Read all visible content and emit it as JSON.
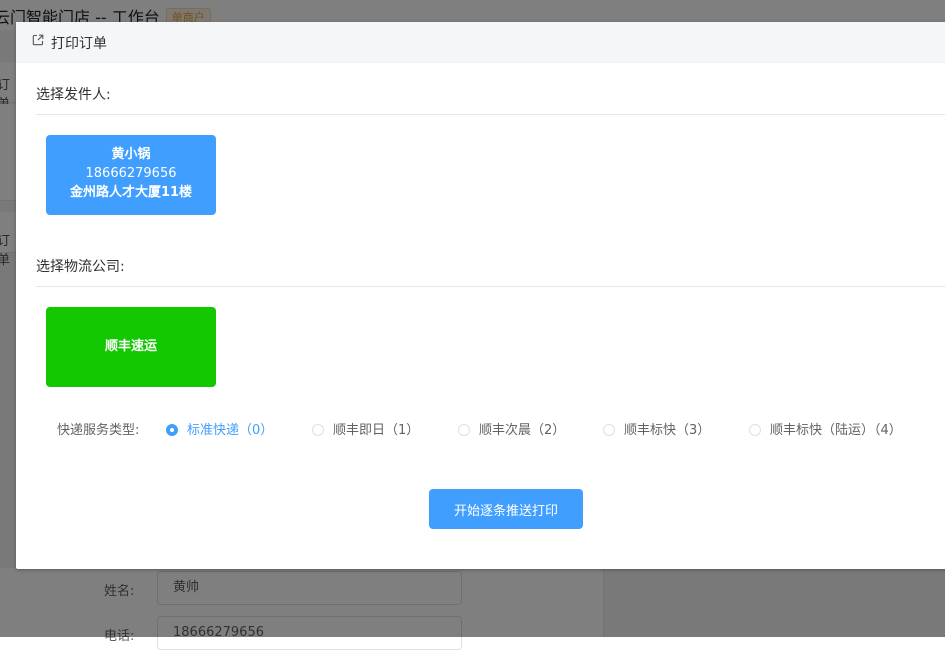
{
  "background": {
    "app_title": "云门智能门店 -- 工作台",
    "badge": "单商户",
    "card_label_1": "订单",
    "card_label_2": "订单",
    "form": {
      "name_label": "姓名:",
      "name_value": "黄帅",
      "phone_label": "电话:",
      "phone_value": "18666279656"
    }
  },
  "dialog": {
    "title": "打印订单",
    "title_icon": "external-link-icon",
    "sender_section_label": "选择发件人:",
    "sender": {
      "name": "黄小锅",
      "phone": "18666279656",
      "address": "金州路人才大厦11楼",
      "color": "#409eff"
    },
    "logistics_section_label": "选择物流公司:",
    "logistics": {
      "name": "顺丰速运",
      "color": "#13c800"
    },
    "service_type_label": "快递服务类型:",
    "service_types": [
      {
        "label": "标准快递（0）",
        "checked": true
      },
      {
        "label": "顺丰即日（1）",
        "checked": false
      },
      {
        "label": "顺丰次晨（2）",
        "checked": false
      },
      {
        "label": "顺丰标快（3）",
        "checked": false
      },
      {
        "label": "顺丰标快（陆运）（4）",
        "checked": false
      }
    ],
    "submit_label": "开始逐条推送打印"
  },
  "colors": {
    "accent": "#409eff",
    "logistics_green": "#13c800",
    "badge_orange": "#e6a23c"
  }
}
